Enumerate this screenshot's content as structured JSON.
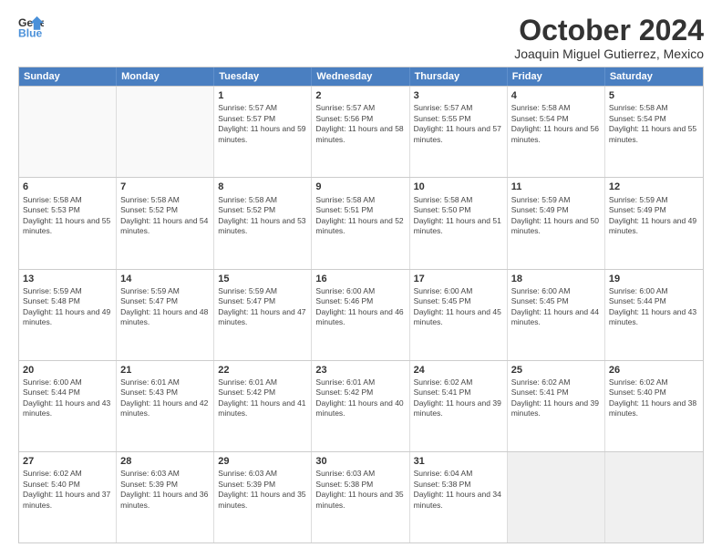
{
  "header": {
    "logo_line1": "General",
    "logo_line2": "Blue",
    "month": "October 2024",
    "location": "Joaquin Miguel Gutierrez, Mexico"
  },
  "days_of_week": [
    "Sunday",
    "Monday",
    "Tuesday",
    "Wednesday",
    "Thursday",
    "Friday",
    "Saturday"
  ],
  "weeks": [
    [
      {
        "day": "",
        "text": "",
        "empty": true
      },
      {
        "day": "",
        "text": "",
        "empty": true
      },
      {
        "day": "1",
        "text": "Sunrise: 5:57 AM\nSunset: 5:57 PM\nDaylight: 11 hours and 59 minutes."
      },
      {
        "day": "2",
        "text": "Sunrise: 5:57 AM\nSunset: 5:56 PM\nDaylight: 11 hours and 58 minutes."
      },
      {
        "day": "3",
        "text": "Sunrise: 5:57 AM\nSunset: 5:55 PM\nDaylight: 11 hours and 57 minutes."
      },
      {
        "day": "4",
        "text": "Sunrise: 5:58 AM\nSunset: 5:54 PM\nDaylight: 11 hours and 56 minutes."
      },
      {
        "day": "5",
        "text": "Sunrise: 5:58 AM\nSunset: 5:54 PM\nDaylight: 11 hours and 55 minutes."
      }
    ],
    [
      {
        "day": "6",
        "text": "Sunrise: 5:58 AM\nSunset: 5:53 PM\nDaylight: 11 hours and 55 minutes."
      },
      {
        "day": "7",
        "text": "Sunrise: 5:58 AM\nSunset: 5:52 PM\nDaylight: 11 hours and 54 minutes."
      },
      {
        "day": "8",
        "text": "Sunrise: 5:58 AM\nSunset: 5:52 PM\nDaylight: 11 hours and 53 minutes."
      },
      {
        "day": "9",
        "text": "Sunrise: 5:58 AM\nSunset: 5:51 PM\nDaylight: 11 hours and 52 minutes."
      },
      {
        "day": "10",
        "text": "Sunrise: 5:58 AM\nSunset: 5:50 PM\nDaylight: 11 hours and 51 minutes."
      },
      {
        "day": "11",
        "text": "Sunrise: 5:59 AM\nSunset: 5:49 PM\nDaylight: 11 hours and 50 minutes."
      },
      {
        "day": "12",
        "text": "Sunrise: 5:59 AM\nSunset: 5:49 PM\nDaylight: 11 hours and 49 minutes."
      }
    ],
    [
      {
        "day": "13",
        "text": "Sunrise: 5:59 AM\nSunset: 5:48 PM\nDaylight: 11 hours and 49 minutes."
      },
      {
        "day": "14",
        "text": "Sunrise: 5:59 AM\nSunset: 5:47 PM\nDaylight: 11 hours and 48 minutes."
      },
      {
        "day": "15",
        "text": "Sunrise: 5:59 AM\nSunset: 5:47 PM\nDaylight: 11 hours and 47 minutes."
      },
      {
        "day": "16",
        "text": "Sunrise: 6:00 AM\nSunset: 5:46 PM\nDaylight: 11 hours and 46 minutes."
      },
      {
        "day": "17",
        "text": "Sunrise: 6:00 AM\nSunset: 5:45 PM\nDaylight: 11 hours and 45 minutes."
      },
      {
        "day": "18",
        "text": "Sunrise: 6:00 AM\nSunset: 5:45 PM\nDaylight: 11 hours and 44 minutes."
      },
      {
        "day": "19",
        "text": "Sunrise: 6:00 AM\nSunset: 5:44 PM\nDaylight: 11 hours and 43 minutes."
      }
    ],
    [
      {
        "day": "20",
        "text": "Sunrise: 6:00 AM\nSunset: 5:44 PM\nDaylight: 11 hours and 43 minutes."
      },
      {
        "day": "21",
        "text": "Sunrise: 6:01 AM\nSunset: 5:43 PM\nDaylight: 11 hours and 42 minutes."
      },
      {
        "day": "22",
        "text": "Sunrise: 6:01 AM\nSunset: 5:42 PM\nDaylight: 11 hours and 41 minutes."
      },
      {
        "day": "23",
        "text": "Sunrise: 6:01 AM\nSunset: 5:42 PM\nDaylight: 11 hours and 40 minutes."
      },
      {
        "day": "24",
        "text": "Sunrise: 6:02 AM\nSunset: 5:41 PM\nDaylight: 11 hours and 39 minutes."
      },
      {
        "day": "25",
        "text": "Sunrise: 6:02 AM\nSunset: 5:41 PM\nDaylight: 11 hours and 39 minutes."
      },
      {
        "day": "26",
        "text": "Sunrise: 6:02 AM\nSunset: 5:40 PM\nDaylight: 11 hours and 38 minutes."
      }
    ],
    [
      {
        "day": "27",
        "text": "Sunrise: 6:02 AM\nSunset: 5:40 PM\nDaylight: 11 hours and 37 minutes."
      },
      {
        "day": "28",
        "text": "Sunrise: 6:03 AM\nSunset: 5:39 PM\nDaylight: 11 hours and 36 minutes."
      },
      {
        "day": "29",
        "text": "Sunrise: 6:03 AM\nSunset: 5:39 PM\nDaylight: 11 hours and 35 minutes."
      },
      {
        "day": "30",
        "text": "Sunrise: 6:03 AM\nSunset: 5:38 PM\nDaylight: 11 hours and 35 minutes."
      },
      {
        "day": "31",
        "text": "Sunrise: 6:04 AM\nSunset: 5:38 PM\nDaylight: 11 hours and 34 minutes."
      },
      {
        "day": "",
        "text": "",
        "empty": true,
        "shaded": true
      },
      {
        "day": "",
        "text": "",
        "empty": true,
        "shaded": true
      }
    ]
  ]
}
